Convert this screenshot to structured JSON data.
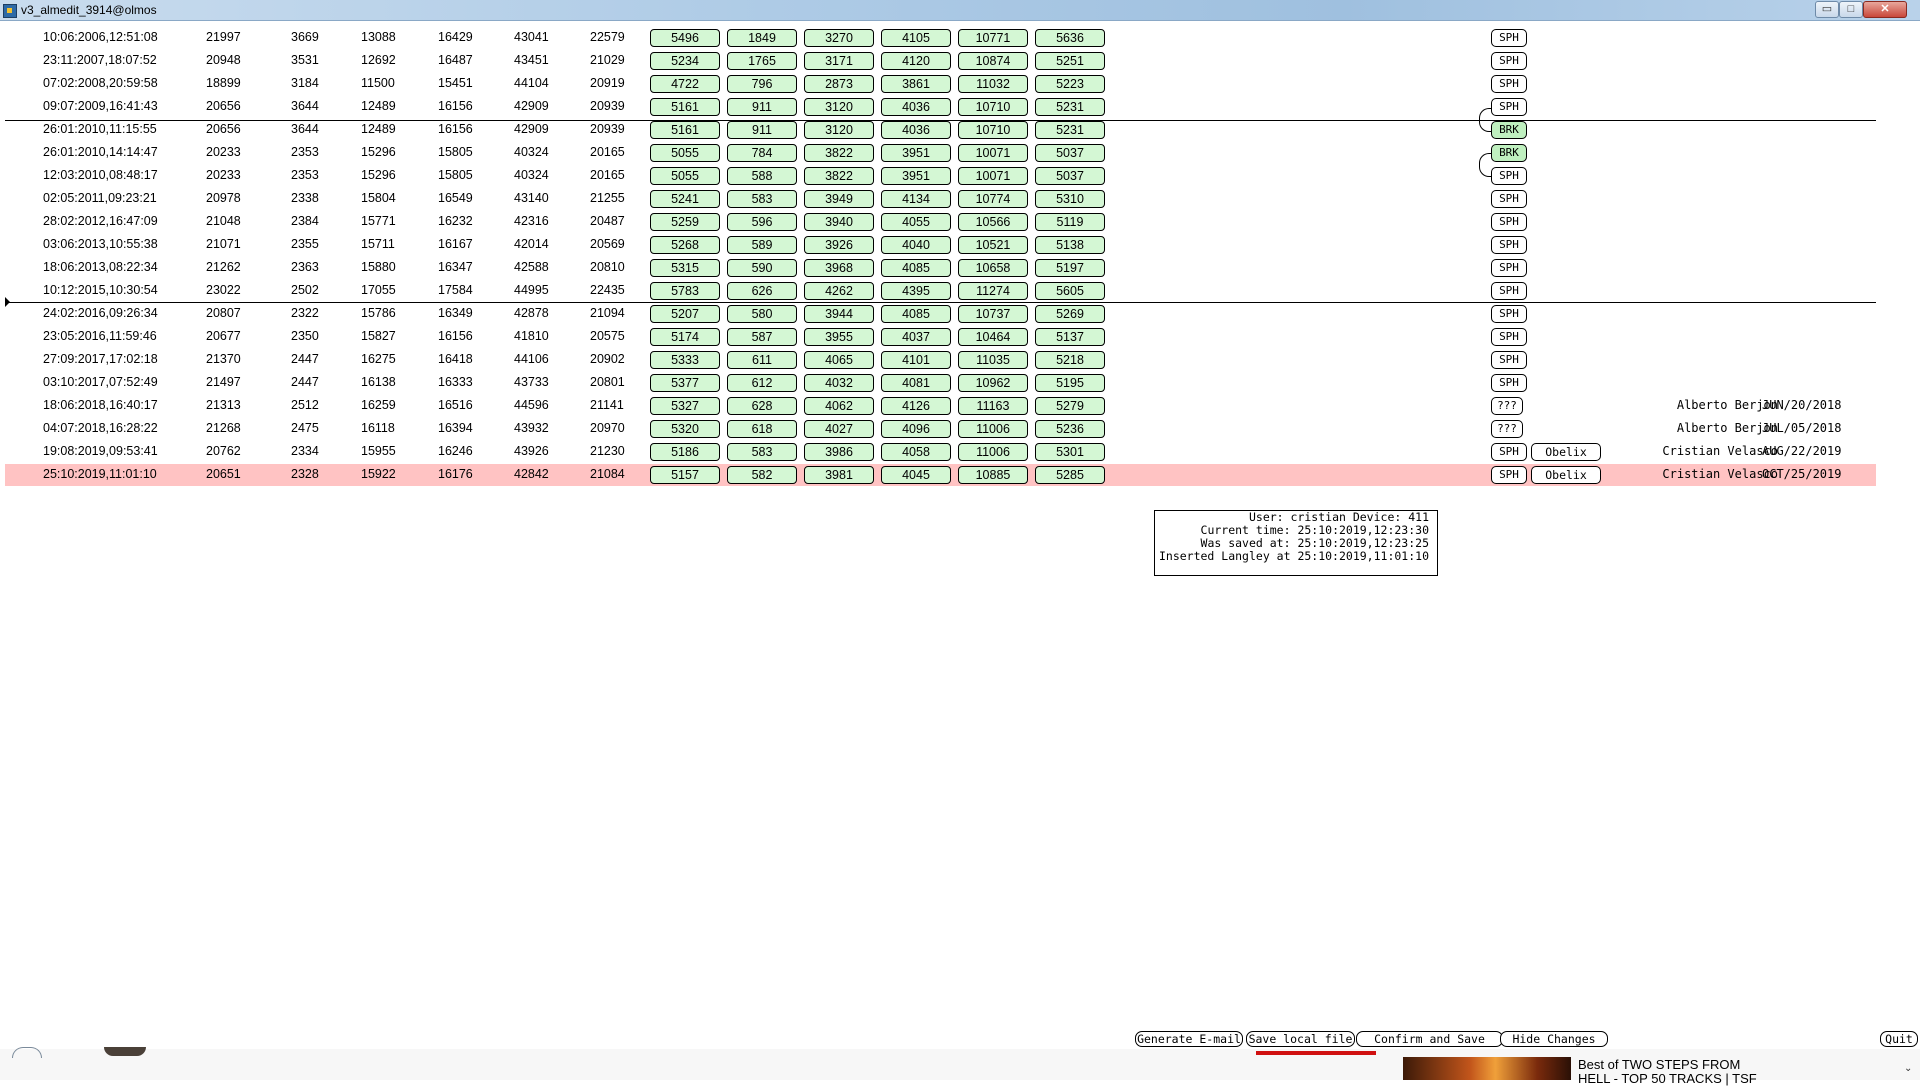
{
  "window": {
    "title": "v3_almedit_3914@olmos",
    "minimize": "▭",
    "maximize": "□",
    "close": "✕"
  },
  "rows": [
    {
      "date": "10:06:2006,12:51:08",
      "n": [
        "21997",
        "3669",
        "13088",
        "16429",
        "43041",
        "22579"
      ],
      "g": [
        "5496",
        "1849",
        "3270",
        "4105",
        "10771",
        "5636"
      ],
      "tag": "SPH"
    },
    {
      "date": "23:11:2007,18:07:52",
      "n": [
        "20948",
        "3531",
        "12692",
        "16487",
        "43451",
        "21029"
      ],
      "g": [
        "5234",
        "1765",
        "3171",
        "4120",
        "10874",
        "5251"
      ],
      "tag": "SPH"
    },
    {
      "date": "07:02:2008,20:59:58",
      "n": [
        "18899",
        "3184",
        "11500",
        "15451",
        "44104",
        "20919"
      ],
      "g": [
        "4722",
        "796",
        "2873",
        "3861",
        "11032",
        "5223"
      ],
      "tag": "SPH"
    },
    {
      "date": "09:07:2009,16:41:43",
      "n": [
        "20656",
        "3644",
        "12489",
        "16156",
        "42909",
        "20939"
      ],
      "g": [
        "5161",
        "911",
        "3120",
        "4036",
        "10710",
        "5231"
      ],
      "tag": "SPH"
    },
    {
      "date": "26:01:2010,11:15:55",
      "n": [
        "20656",
        "3644",
        "12489",
        "16156",
        "42909",
        "20939"
      ],
      "g": [
        "5161",
        "911",
        "3120",
        "4036",
        "10710",
        "5231"
      ],
      "tag": "BRK"
    },
    {
      "date": "26:01:2010,14:14:47",
      "n": [
        "20233",
        "2353",
        "15296",
        "15805",
        "40324",
        "20165"
      ],
      "g": [
        "5055",
        "784",
        "3822",
        "3951",
        "10071",
        "5037"
      ],
      "tag": "BRK"
    },
    {
      "date": "12:03:2010,08:48:17",
      "n": [
        "20233",
        "2353",
        "15296",
        "15805",
        "40324",
        "20165"
      ],
      "g": [
        "5055",
        "588",
        "3822",
        "3951",
        "10071",
        "5037"
      ],
      "tag": "SPH"
    },
    {
      "date": "02:05:2011,09:23:21",
      "n": [
        "20978",
        "2338",
        "15804",
        "16549",
        "43140",
        "21255"
      ],
      "g": [
        "5241",
        "583",
        "3949",
        "4134",
        "10774",
        "5310"
      ],
      "tag": "SPH"
    },
    {
      "date": "28:02:2012,16:47:09",
      "n": [
        "21048",
        "2384",
        "15771",
        "16232",
        "42316",
        "20487"
      ],
      "g": [
        "5259",
        "596",
        "3940",
        "4055",
        "10566",
        "5119"
      ],
      "tag": "SPH"
    },
    {
      "date": "03:06:2013,10:55:38",
      "n": [
        "21071",
        "2355",
        "15711",
        "16167",
        "42014",
        "20569"
      ],
      "g": [
        "5268",
        "589",
        "3926",
        "4040",
        "10521",
        "5138"
      ],
      "tag": "SPH"
    },
    {
      "date": "18:06:2013,08:22:34",
      "n": [
        "21262",
        "2363",
        "15880",
        "16347",
        "42588",
        "20810"
      ],
      "g": [
        "5315",
        "590",
        "3968",
        "4085",
        "10658",
        "5197"
      ],
      "tag": "SPH"
    },
    {
      "date": "10:12:2015,10:30:54",
      "n": [
        "23022",
        "2502",
        "17055",
        "17584",
        "44995",
        "22435"
      ],
      "g": [
        "5783",
        "626",
        "4262",
        "4395",
        "11274",
        "5605"
      ],
      "tag": "SPH"
    },
    {
      "date": "24:02:2016,09:26:34",
      "n": [
        "20807",
        "2322",
        "15786",
        "16349",
        "42878",
        "21094"
      ],
      "g": [
        "5207",
        "580",
        "3944",
        "4085",
        "10737",
        "5269"
      ],
      "tag": "SPH"
    },
    {
      "date": "23:05:2016,11:59:46",
      "n": [
        "20677",
        "2350",
        "15827",
        "16156",
        "41810",
        "20575"
      ],
      "g": [
        "5174",
        "587",
        "3955",
        "4037",
        "10464",
        "5137"
      ],
      "tag": "SPH"
    },
    {
      "date": "27:09:2017,17:02:18",
      "n": [
        "21370",
        "2447",
        "16275",
        "16418",
        "44106",
        "20902"
      ],
      "g": [
        "5333",
        "611",
        "4065",
        "4101",
        "11035",
        "5218"
      ],
      "tag": "SPH"
    },
    {
      "date": "03:10:2017,07:52:49",
      "n": [
        "21497",
        "2447",
        "16138",
        "16333",
        "43733",
        "20801"
      ],
      "g": [
        "5377",
        "612",
        "4032",
        "4081",
        "10962",
        "5195"
      ],
      "tag": "SPH"
    },
    {
      "date": "18:06:2018,16:40:17",
      "n": [
        "21313",
        "2512",
        "16259",
        "16516",
        "44596",
        "21141"
      ],
      "g": [
        "5327",
        "628",
        "4062",
        "4126",
        "11163",
        "5279"
      ],
      "tag": "???",
      "user": "Alberto Berjon",
      "udate": "JUN/20/2018"
    },
    {
      "date": "04:07:2018,16:28:22",
      "n": [
        "21268",
        "2475",
        "16118",
        "16394",
        "43932",
        "20970"
      ],
      "g": [
        "5320",
        "618",
        "4027",
        "4096",
        "11006",
        "5236"
      ],
      "tag": "???",
      "user": "Alberto Berjon",
      "udate": "JUL/05/2018"
    },
    {
      "date": "19:08:2019,09:53:41",
      "n": [
        "20762",
        "2334",
        "15955",
        "16246",
        "43926",
        "21230"
      ],
      "g": [
        "5186",
        "583",
        "3986",
        "4058",
        "11006",
        "5301"
      ],
      "tag": "SPH",
      "device": "Obelix",
      "user": "Cristian Velasco",
      "udate": "AUG/22/2019"
    },
    {
      "date": "25:10:2019,11:01:10",
      "n": [
        "20651",
        "2328",
        "15922",
        "16176",
        "42842",
        "21084"
      ],
      "g": [
        "5157",
        "582",
        "3981",
        "4045",
        "10885",
        "5285"
      ],
      "tag": "SPH",
      "device": "Obelix",
      "user": "Cristian Velasco",
      "udate": "OCT/25/2019"
    }
  ],
  "info": {
    "line1": "User: cristian Device: 411",
    "line2": "Current time: 25:10:2019,12:23:30",
    "line3": "Was saved at: 25:10:2019,12:23:25",
    "line4": "Inserted Langley at 25:10:2019,11:01:10"
  },
  "buttons": {
    "email": "Generate E-mail",
    "save_local": "Save local file",
    "confirm": "Confirm and Save",
    "hide": "Hide Changes",
    "quit": "Quit"
  },
  "taskbar": {
    "promo_line1": "Best of TWO STEPS FROM",
    "promo_line2": "HELL - TOP 50 TRACKS | TSF",
    "scroll_icon": "chevron-down-icon"
  },
  "colors": {
    "highlight_row": "#ffc3c3",
    "value_box": "#d4f7d4",
    "brk_tag": "#bff0bf",
    "save_underline": "#d01010"
  }
}
